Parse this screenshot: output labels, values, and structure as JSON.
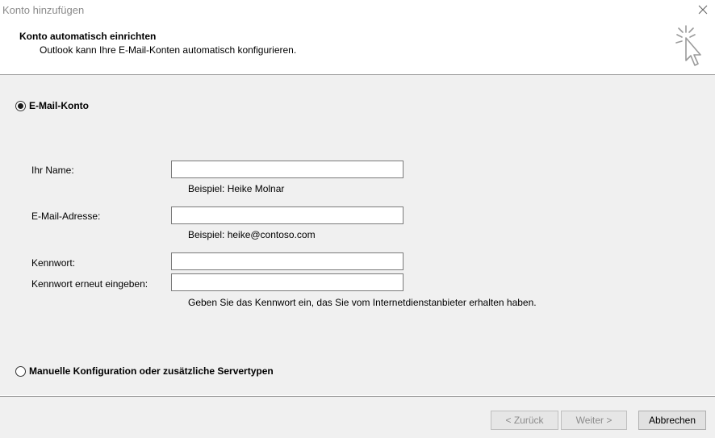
{
  "window": {
    "title": "Konto hinzufügen",
    "close_icon": "close-icon"
  },
  "header": {
    "title": "Konto automatisch einrichten",
    "subtitle": "Outlook kann Ihre E-Mail-Konten automatisch konfigurieren.",
    "icon": "wizard-cursor-icon"
  },
  "options": {
    "email_account": {
      "label": "E-Mail-Konto",
      "checked": true
    },
    "manual_config": {
      "label": "Manuelle Konfiguration oder zusätzliche Servertypen",
      "checked": false
    }
  },
  "form": {
    "name": {
      "label": "Ihr Name:",
      "value": "",
      "hint": "Beispiel: Heike Molnar"
    },
    "email": {
      "label": "E-Mail-Adresse:",
      "value": "",
      "hint": "Beispiel: heike@contoso.com"
    },
    "password": {
      "label": "Kennwort:",
      "value": ""
    },
    "password_repeat": {
      "label": "Kennwort erneut eingeben:",
      "value": ""
    },
    "password_hint": "Geben Sie das Kennwort ein, das Sie vom Internetdienstanbieter erhalten haben."
  },
  "footer": {
    "back_label": "< Zurück",
    "next_label": "Weiter >",
    "cancel_label": "Abbrechen"
  }
}
